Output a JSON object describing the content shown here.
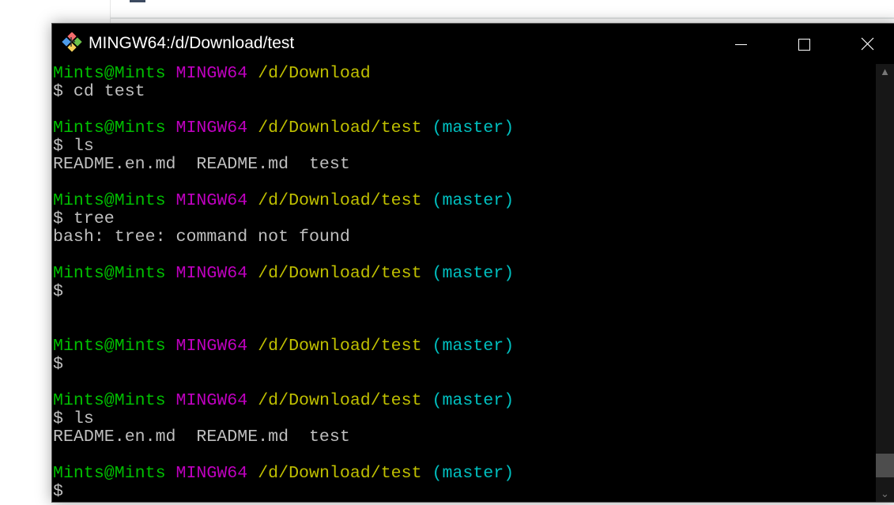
{
  "window": {
    "title": "MINGW64:/d/Download/test",
    "icon": "git-bash-icon"
  },
  "colors": {
    "green": "#00bf00",
    "magenta": "#bf00bf",
    "yellow": "#bfbf00",
    "cyan": "#00bfbf",
    "text": "#bfbfbf"
  },
  "terminal": {
    "lines": [
      [
        [
          "Mints@Mints ",
          "green"
        ],
        [
          "MINGW64 ",
          "magenta"
        ],
        [
          "/d/Download",
          "yellow"
        ]
      ],
      [
        [
          "$ cd test",
          "text"
        ]
      ],
      [],
      [
        [
          "Mints@Mints ",
          "green"
        ],
        [
          "MINGW64 ",
          "magenta"
        ],
        [
          "/d/Download/test ",
          "yellow"
        ],
        [
          "(master)",
          "cyan"
        ]
      ],
      [
        [
          "$ ls",
          "text"
        ]
      ],
      [
        [
          "README.en.md  README.md  test",
          "text"
        ]
      ],
      [],
      [
        [
          "Mints@Mints ",
          "green"
        ],
        [
          "MINGW64 ",
          "magenta"
        ],
        [
          "/d/Download/test ",
          "yellow"
        ],
        [
          "(master)",
          "cyan"
        ]
      ],
      [
        [
          "$ tree",
          "text"
        ]
      ],
      [
        [
          "bash: tree: command not found",
          "text"
        ]
      ],
      [],
      [
        [
          "Mints@Mints ",
          "green"
        ],
        [
          "MINGW64 ",
          "magenta"
        ],
        [
          "/d/Download/test ",
          "yellow"
        ],
        [
          "(master)",
          "cyan"
        ]
      ],
      [
        [
          "$",
          "text"
        ]
      ],
      [],
      [],
      [
        [
          "Mints@Mints ",
          "green"
        ],
        [
          "MINGW64 ",
          "magenta"
        ],
        [
          "/d/Download/test ",
          "yellow"
        ],
        [
          "(master)",
          "cyan"
        ]
      ],
      [
        [
          "$",
          "text"
        ]
      ],
      [],
      [
        [
          "Mints@Mints ",
          "green"
        ],
        [
          "MINGW64 ",
          "magenta"
        ],
        [
          "/d/Download/test ",
          "yellow"
        ],
        [
          "(master)",
          "cyan"
        ]
      ],
      [
        [
          "$ ls",
          "text"
        ]
      ],
      [
        [
          "README.en.md  README.md  test",
          "text"
        ]
      ],
      [],
      [
        [
          "Mints@Mints ",
          "green"
        ],
        [
          "MINGW64 ",
          "magenta"
        ],
        [
          "/d/Download/test ",
          "yellow"
        ],
        [
          "(master)",
          "cyan"
        ]
      ],
      [
        [
          "$",
          "text"
        ]
      ]
    ]
  },
  "scrollbar": {
    "position_fraction": 0.97
  }
}
